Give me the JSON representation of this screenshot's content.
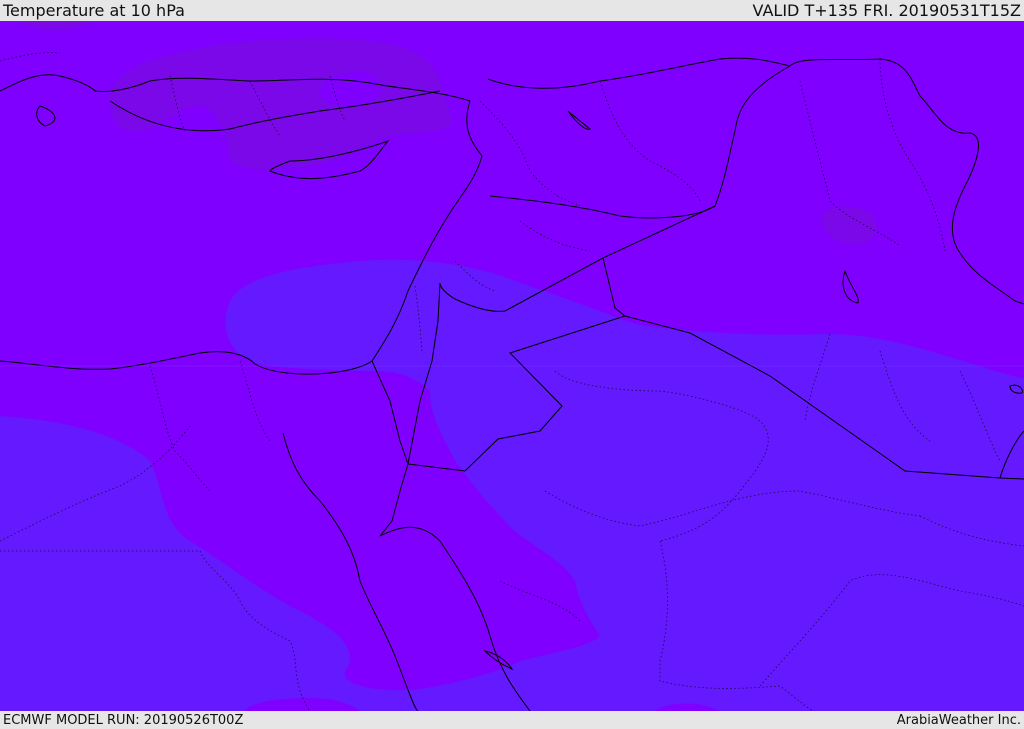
{
  "header": {
    "title": "Temperature at 10 hPa",
    "valid": "VALID T+135 FRI. 20190531T15Z"
  },
  "footer": {
    "model_run": "ECMWF MODEL RUN: 20190526T00Z",
    "credit": "ArabiaWeather Inc."
  },
  "colors": {
    "band_warm": "#7f00ff",
    "band_cool": "#6419ff",
    "band_warmest": "#7a08e8",
    "border": "#000000"
  },
  "icons": []
}
